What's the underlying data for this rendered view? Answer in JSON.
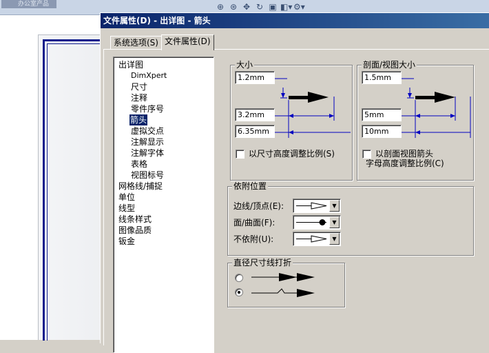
{
  "background_app": {
    "doc_tab": "办公室产品",
    "toolbar_icons": [
      "zoom-fit-icon",
      "zoom-area-icon",
      "pan-icon",
      "rotate-icon",
      "view-orientation-icon",
      "display-style-icon",
      "hide-show-icon"
    ]
  },
  "dialog": {
    "title": "文件属性(D) - 出详图 - 箭头",
    "tabs": [
      {
        "label": "系统选项(S)"
      },
      {
        "label": "文件属性(D)"
      }
    ],
    "tree": [
      {
        "label": "出详图",
        "level": 0
      },
      {
        "label": "DimXpert",
        "level": 1
      },
      {
        "label": "尺寸",
        "level": 1
      },
      {
        "label": "注释",
        "level": 1
      },
      {
        "label": "零件序号",
        "level": 1
      },
      {
        "label": "箭头",
        "level": 1,
        "selected": true
      },
      {
        "label": "虚拟交点",
        "level": 1
      },
      {
        "label": "注解显示",
        "level": 1
      },
      {
        "label": "注解字体",
        "level": 1
      },
      {
        "label": "表格",
        "level": 1
      },
      {
        "label": "视图标号",
        "level": 1
      },
      {
        "label": "网格线/捕捉",
        "level": 0
      },
      {
        "label": "单位",
        "level": 0
      },
      {
        "label": "线型",
        "level": 0
      },
      {
        "label": "线条样式",
        "level": 0
      },
      {
        "label": "图像品质",
        "level": 0
      },
      {
        "label": "钣金",
        "level": 0
      }
    ],
    "size_group": {
      "title": "大小",
      "height_value": "1.2mm",
      "width_value": "3.2mm",
      "length_value": "6.35mm",
      "scale_checkbox": "以尺寸高度调整比例(S)",
      "scale_checked": false
    },
    "section_group": {
      "title": "剖面/视图大小",
      "height_value": "1.5mm",
      "width_value": "5mm",
      "length_value": "10mm",
      "scale_checkbox_line1": "以剖面视图箭头",
      "scale_checkbox_line2": "字母高度调整比例(C)",
      "scale_checked": false
    },
    "attach_group": {
      "title": "依附位置",
      "rows": [
        {
          "label": "边线/顶点(E):",
          "style": "open-arrow"
        },
        {
          "label": "面/曲面(F):",
          "style": "dot"
        },
        {
          "label": "不依附(U):",
          "style": "open-arrow"
        }
      ]
    },
    "break_group": {
      "title": "直径尺寸线打折",
      "options": [
        {
          "style": "straight",
          "selected": false
        },
        {
          "style": "jogged",
          "selected": true
        }
      ]
    }
  },
  "colors": {
    "title_bar_start": "#0a246a",
    "title_bar_end": "#3a6ea5",
    "dimension_lines": "#0000c0",
    "dialog_face": "#d4d0c8"
  }
}
